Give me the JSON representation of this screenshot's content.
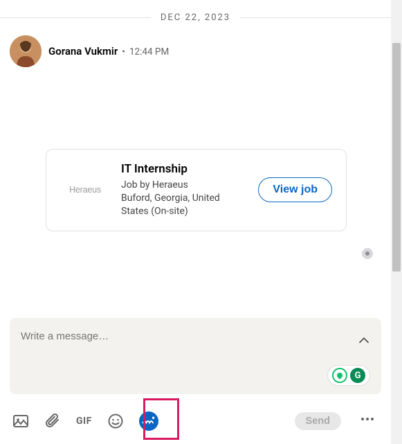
{
  "date_divider": "DEC 22, 2023",
  "message": {
    "sender_name": "Gorana Vukmir",
    "separator": "•",
    "timestamp": "12:44 PM"
  },
  "job_card": {
    "logo_text": "Heraeus",
    "title": "IT Internship",
    "company_line": "Job by Heraeus",
    "location_line": "Buford, Georgia, United States (On-site)",
    "cta": "View job"
  },
  "compose": {
    "placeholder": "Write a message…"
  },
  "toolbar": {
    "gif_label": "GIF",
    "send_label": "Send"
  },
  "ext": {
    "g_label": "G"
  },
  "icons": {
    "image": "image-icon",
    "attach": "attachment-icon",
    "gif": "gif-icon",
    "emoji": "emoji-icon",
    "wishcard": "wishcard-icon",
    "collapse": "chevron-up-icon",
    "more": "more-icon",
    "read": "read-receipt-avatar"
  }
}
